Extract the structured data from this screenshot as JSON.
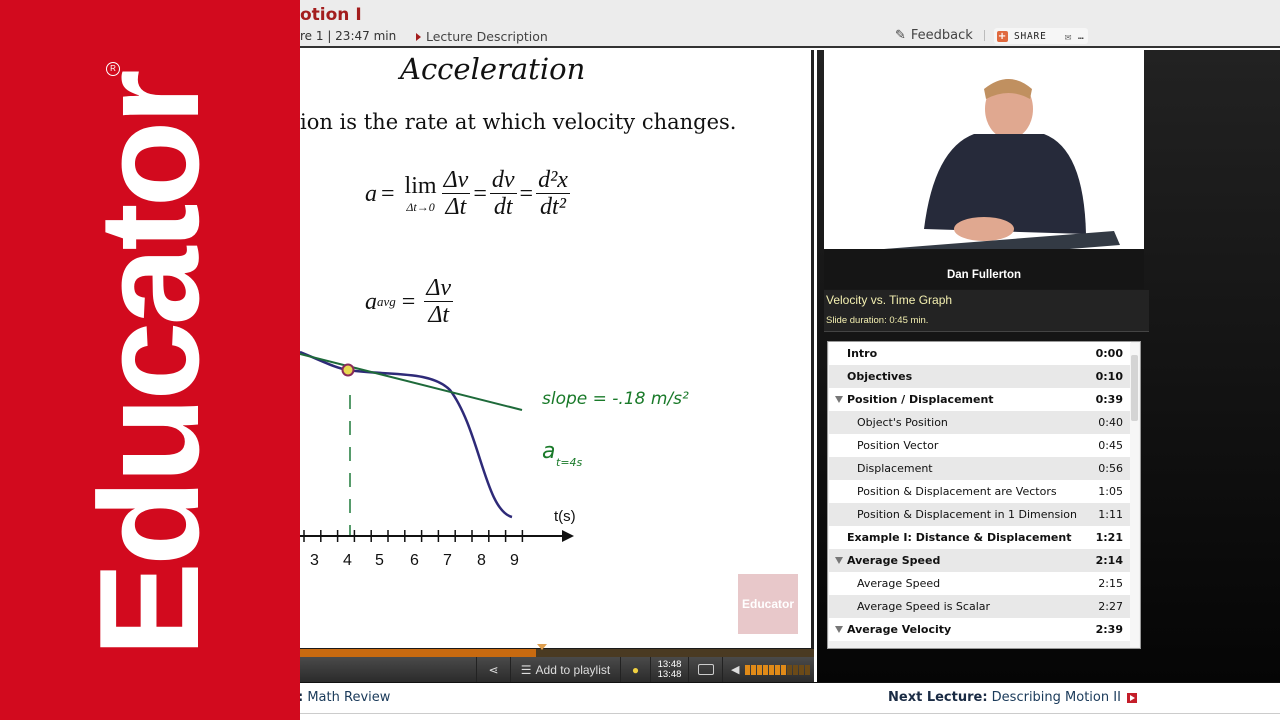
{
  "header": {
    "title": "otion I",
    "meta": "re 1 | 23:47 min",
    "description_link": "Lecture Description",
    "feedback": "Feedback",
    "share": "SHARE",
    "more": "…"
  },
  "brand": {
    "logo": "Educator",
    "reg": "R"
  },
  "slide": {
    "title": "Acceleration",
    "text": "ion is the rate at which velocity changes.",
    "eq1": {
      "a": "a",
      "eq": "=",
      "lim": "lim",
      "lim_sub": "Δt→0",
      "f1_num": "Δv",
      "f1_den": "Δt",
      "f2_num": "dv",
      "f2_den": "dt",
      "f3_num": "d²x",
      "f3_den": "dt²"
    },
    "eq2": {
      "a": "a",
      "sub": "avg",
      "eq": "=",
      "num": "Δv",
      "den": "Δt"
    },
    "graph": {
      "axis_label": "t(s)",
      "ticks": [
        "3",
        "4",
        "5",
        "6",
        "7",
        "8",
        "9"
      ],
      "annotation_slope": "slope = -.18 m/s²",
      "annotation_a": "a",
      "annotation_a_sub": "t=4s"
    },
    "watermark": "Educator"
  },
  "player": {
    "progress": 0.46,
    "add_to_playlist": "Add to playlist",
    "time_current": "13:48",
    "time_total": "13:48",
    "volume_level": 0.6
  },
  "presenter": {
    "name": "Dan Fullerton",
    "slide_title": "Velocity vs. Time Graph",
    "slide_duration": "Slide duration: 0:45 min."
  },
  "toc": [
    {
      "label": "Intro",
      "time": "0:00",
      "level": 0,
      "expandable": false
    },
    {
      "label": "Objectives",
      "time": "0:10",
      "level": 0,
      "expandable": false
    },
    {
      "label": "Position / Displacement",
      "time": "0:39",
      "level": 0,
      "expandable": true
    },
    {
      "label": "Object's Position",
      "time": "0:40",
      "level": 1
    },
    {
      "label": "Position Vector",
      "time": "0:45",
      "level": 1
    },
    {
      "label": "Displacement",
      "time": "0:56",
      "level": 1
    },
    {
      "label": "Position & Displacement are Vectors",
      "time": "1:05",
      "level": 1
    },
    {
      "label": "Position & Displacement in 1 Dimension",
      "time": "1:11",
      "level": 1
    },
    {
      "label": "Example I: Distance & Displacement",
      "time": "1:21",
      "level": 0,
      "expandable": false
    },
    {
      "label": "Average Speed",
      "time": "2:14",
      "level": 0,
      "expandable": true
    },
    {
      "label": "Average Speed",
      "time": "2:15",
      "level": 1
    },
    {
      "label": "Average Speed is Scalar",
      "time": "2:27",
      "level": 1
    },
    {
      "label": "Average Velocity",
      "time": "2:39",
      "level": 0,
      "expandable": true
    }
  ],
  "footer": {
    "prev_label": ":",
    "prev_title": "Math Review",
    "next_label": "Next Lecture:",
    "next_title": "Describing Motion II"
  }
}
